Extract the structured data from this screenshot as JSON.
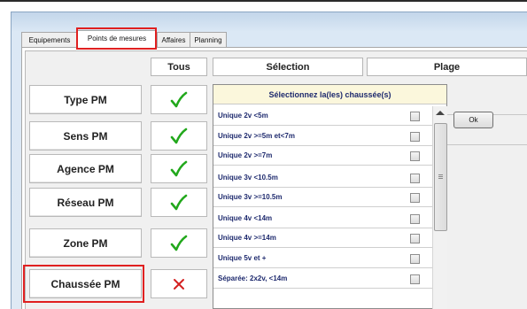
{
  "tabs": [
    {
      "label": "Equipements"
    },
    {
      "label": "Points de mesures"
    },
    {
      "label": "Affaires"
    },
    {
      "label": "Planning"
    }
  ],
  "columns": {
    "tous": "Tous",
    "selection": "Sélection",
    "plage": "Plage"
  },
  "rows": [
    {
      "label": "Type PM",
      "tous_state": "checked"
    },
    {
      "label": "Sens PM",
      "tous_state": "checked"
    },
    {
      "label": "Agence PM",
      "tous_state": "checked"
    },
    {
      "label": "Réseau PM",
      "tous_state": "checked"
    },
    {
      "label": "Zone PM",
      "tous_state": "checked"
    },
    {
      "label": "Chaussée PM",
      "tous_state": "unchecked"
    }
  ],
  "popup": {
    "title": "Sélectionnez la(les) chaussée(s)",
    "items": [
      {
        "label": "Unique 2v <5m",
        "checked": false
      },
      {
        "label": "Unique 2v >=5m et<7m",
        "checked": false
      },
      {
        "label": "Unique 2v >=7m",
        "checked": false
      },
      {
        "label": "Unique 3v <10.5m",
        "checked": false
      },
      {
        "label": "Unique 3v >=10.5m",
        "checked": false
      },
      {
        "label": "Unique 4v <14m",
        "checked": false
      },
      {
        "label": "Unique 4v >=14m",
        "checked": false
      },
      {
        "label": "Unique 5v et +",
        "checked": false
      },
      {
        "label": "Séparée: 2x2v, <14m",
        "checked": false
      }
    ],
    "ok_label": "Ok"
  },
  "colors": {
    "highlight": "#e02020",
    "check_green": "#22a81c",
    "cross_red": "#d42020",
    "popup_title_bg": "#fbf7dc",
    "popup_text": "#1e2a6e"
  },
  "icons": {
    "checked": "green-checkmark-icon",
    "unchecked": "red-x-icon"
  }
}
